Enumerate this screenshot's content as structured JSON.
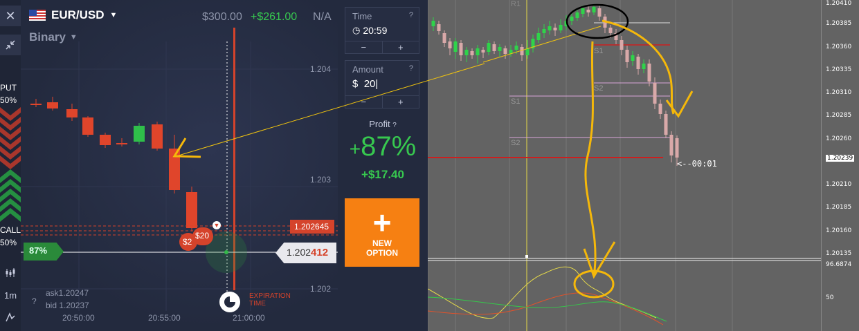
{
  "asset": {
    "flag_icon": "us-flag-icon",
    "symbol": "EUR/USD",
    "type": "Binary"
  },
  "header": {
    "balance": "$300.00",
    "profit_total": "+$261.00",
    "na": "N/A"
  },
  "left_toolbar": {
    "put_label": "PUT",
    "put_pct": "50%",
    "call_label": "CALL",
    "call_pct": "50%",
    "timeframe": "1m"
  },
  "chart": {
    "y_ticks": [
      "1.204",
      "1.203",
      "1.202"
    ],
    "x_ticks": [
      "20:50:00",
      "20:55:00",
      "21:00:00"
    ],
    "current_price_prefix": "1.202",
    "current_price_suffix": "412",
    "strike_price": "1.202645",
    "bet_badge": "$20",
    "bet_badge_back": "$2",
    "pct_badge": "87%",
    "ask": "ask1.20247",
    "bid": "bid 1.20237",
    "expiration_label": "EXPIRATION\nTIME"
  },
  "controls": {
    "time_label": "Time",
    "time_value": "20:59",
    "amount_label": "Amount",
    "amount_currency": "$",
    "amount_value": "20",
    "minus": "−",
    "plus": "+",
    "profit_label": "Profit",
    "profit_pct": "87%",
    "profit_plus": "+",
    "profit_amount": "+$17.40",
    "new_option_line1": "NEW",
    "new_option_line2": "OPTION"
  },
  "mt_chart": {
    "price_levels": [
      "1.20410",
      "1.20385",
      "1.20360",
      "1.20335",
      "1.20310",
      "1.20285",
      "1.20260",
      "1.20239",
      "1.20210",
      "1.20185",
      "1.20160",
      "1.20135"
    ],
    "osc_levels": [
      "96.6874",
      "50"
    ],
    "level_labels": [
      "R1",
      "S1",
      "S2",
      "S1",
      "S2"
    ],
    "countdown": "<--00:01"
  },
  "colors": {
    "accent": "#f68012",
    "up": "#2fbf4a",
    "down": "#e0452b",
    "profit": "#37c84f"
  }
}
